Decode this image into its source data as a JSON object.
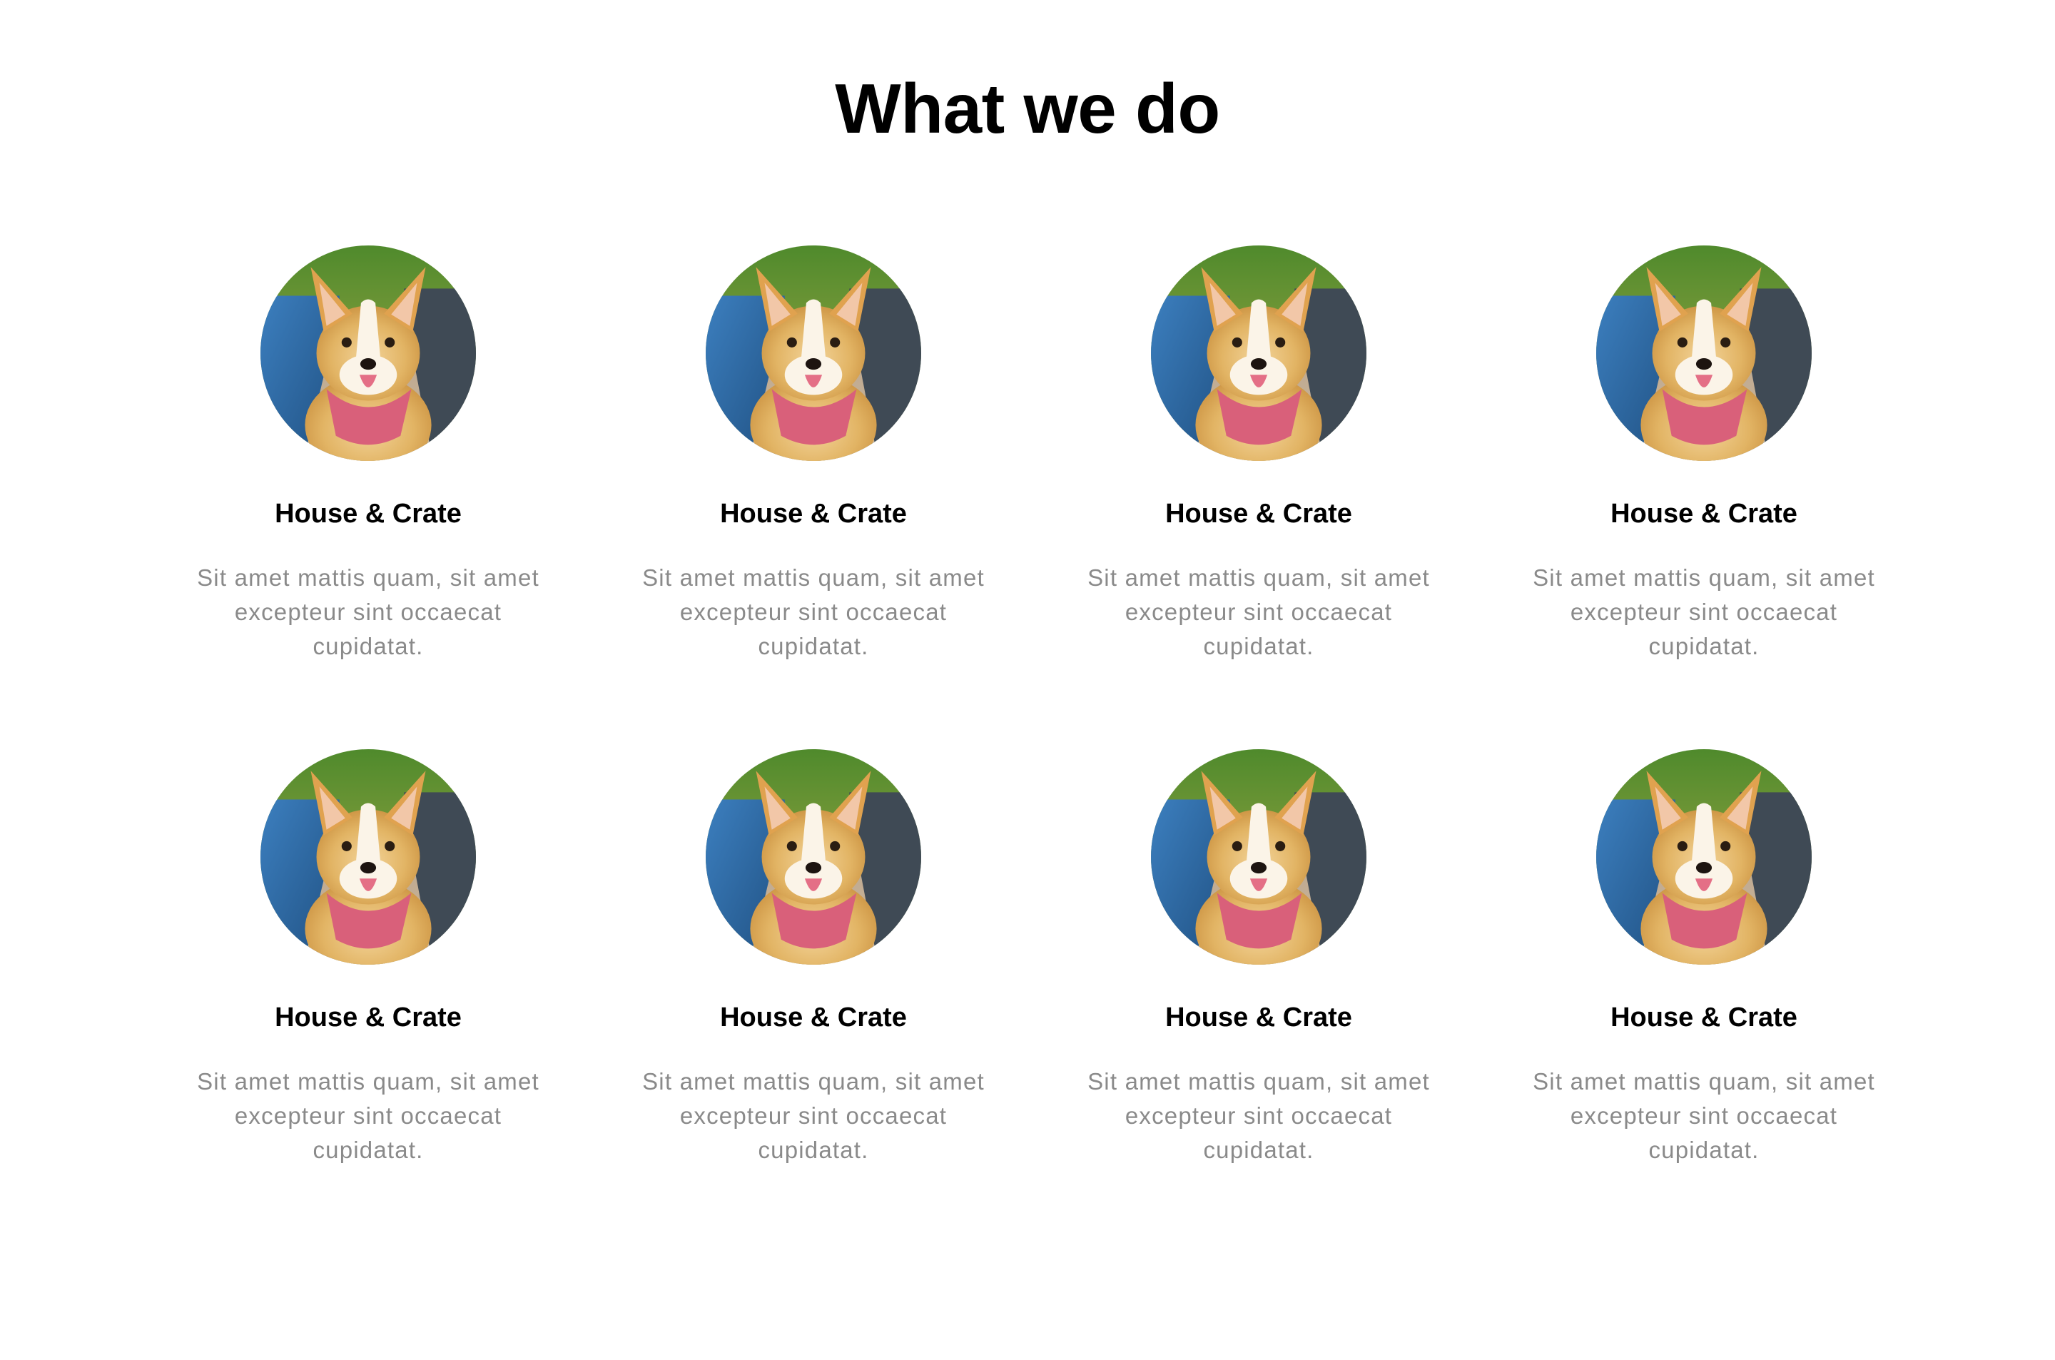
{
  "section": {
    "title": "What we do"
  },
  "cards": [
    {
      "title": "House & Crate",
      "text": "Sit amet mattis quam, sit amet excepteur sint occaecat cupidatat.",
      "image_icon": "corgi-photo"
    },
    {
      "title": "House & Crate",
      "text": "Sit amet mattis quam, sit amet excepteur sint occaecat cupidatat.",
      "image_icon": "corgi-photo"
    },
    {
      "title": "House & Crate",
      "text": "Sit amet mattis quam, sit amet excepteur sint occaecat cupidatat.",
      "image_icon": "corgi-photo"
    },
    {
      "title": "House & Crate",
      "text": "Sit amet mattis quam, sit amet excepteur sint occaecat cupidatat.",
      "image_icon": "corgi-photo"
    },
    {
      "title": "House & Crate",
      "text": "Sit amet mattis quam, sit amet excepteur sint occaecat cupidatat.",
      "image_icon": "corgi-photo"
    },
    {
      "title": "House & Crate",
      "text": "Sit amet mattis quam, sit amet excepteur sint occaecat cupidatat.",
      "image_icon": "corgi-photo"
    },
    {
      "title": "House & Crate",
      "text": "Sit amet mattis quam, sit amet excepteur sint occaecat cupidatat.",
      "image_icon": "corgi-photo"
    },
    {
      "title": "House & Crate",
      "text": "Sit amet mattis quam, sit amet excepteur sint occaecat cupidatat.",
      "image_icon": "corgi-photo"
    }
  ],
  "colors": {
    "title": "#000000",
    "body_text": "#8a8a8a",
    "background": "#ffffff"
  }
}
